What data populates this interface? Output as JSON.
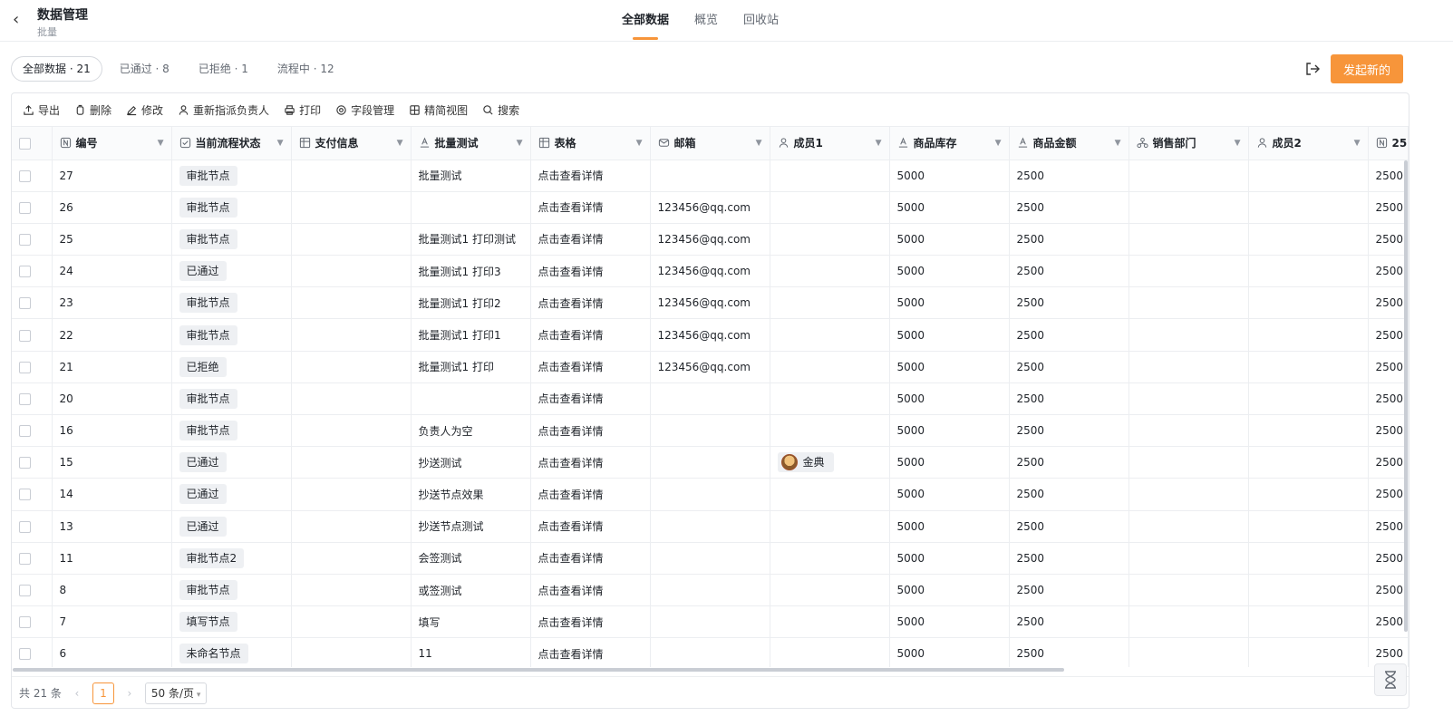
{
  "header": {
    "title": "数据管理",
    "subtitle": "批量"
  },
  "main_tabs": [
    {
      "label": "全部数据",
      "active": true
    },
    {
      "label": "概览",
      "active": false
    },
    {
      "label": "回收站",
      "active": false
    }
  ],
  "filters": [
    {
      "label": "全部数据 · 21",
      "active": true
    },
    {
      "label": "已通过 · 8",
      "active": false
    },
    {
      "label": "已拒绝 · 1",
      "active": false
    },
    {
      "label": "流程中 · 12",
      "active": false
    }
  ],
  "primary_button": "发起新的",
  "toolbar": [
    {
      "label": "导出",
      "icon": "export-icon"
    },
    {
      "label": "删除",
      "icon": "trash-icon"
    },
    {
      "label": "修改",
      "icon": "edit-icon"
    },
    {
      "label": "重新指派负责人",
      "icon": "user-icon"
    },
    {
      "label": "打印",
      "icon": "printer-icon"
    },
    {
      "label": "字段管理",
      "icon": "settings-icon"
    },
    {
      "label": "精简视图",
      "icon": "grid-icon"
    },
    {
      "label": "搜索",
      "icon": "search-icon"
    }
  ],
  "columns": [
    {
      "label": "编号",
      "icon": "number-icon"
    },
    {
      "label": "当前流程状态",
      "icon": "status-icon"
    },
    {
      "label": "支付信息",
      "icon": "table-icon"
    },
    {
      "label": "批量测试",
      "icon": "text-icon"
    },
    {
      "label": "表格",
      "icon": "table-icon"
    },
    {
      "label": "邮箱",
      "icon": "mail-icon"
    },
    {
      "label": "成员1",
      "icon": "user-icon"
    },
    {
      "label": "商品库存",
      "icon": "text-icon"
    },
    {
      "label": "商品金额",
      "icon": "text-icon"
    },
    {
      "label": "销售部门",
      "icon": "department-icon"
    },
    {
      "label": "成员2",
      "icon": "user-icon"
    },
    {
      "label": "25",
      "icon": "number-icon"
    }
  ],
  "rows": [
    {
      "id": "27",
      "status": "审批节点",
      "pay": "",
      "batch": "批量测试",
      "table": "点击查看详情",
      "email": "",
      "member1": "",
      "stock": "5000",
      "amount": "2500",
      "dept": "",
      "member2": "",
      "extra": "2500"
    },
    {
      "id": "26",
      "status": "审批节点",
      "pay": "",
      "batch": "",
      "table": "点击查看详情",
      "email": "123456@qq.com",
      "member1": "",
      "stock": "5000",
      "amount": "2500",
      "dept": "",
      "member2": "",
      "extra": "2500"
    },
    {
      "id": "25",
      "status": "审批节点",
      "pay": "",
      "batch": "批量测试1 打印测试",
      "table": "点击查看详情",
      "email": "123456@qq.com",
      "member1": "",
      "stock": "5000",
      "amount": "2500",
      "dept": "",
      "member2": "",
      "extra": "2500"
    },
    {
      "id": "24",
      "status": "已通过",
      "pay": "",
      "batch": "批量测试1 打印3",
      "table": "点击查看详情",
      "email": "123456@qq.com",
      "member1": "",
      "stock": "5000",
      "amount": "2500",
      "dept": "",
      "member2": "",
      "extra": "2500"
    },
    {
      "id": "23",
      "status": "审批节点",
      "pay": "",
      "batch": "批量测试1 打印2",
      "table": "点击查看详情",
      "email": "123456@qq.com",
      "member1": "",
      "stock": "5000",
      "amount": "2500",
      "dept": "",
      "member2": "",
      "extra": "2500"
    },
    {
      "id": "22",
      "status": "审批节点",
      "pay": "",
      "batch": "批量测试1 打印1",
      "table": "点击查看详情",
      "email": "123456@qq.com",
      "member1": "",
      "stock": "5000",
      "amount": "2500",
      "dept": "",
      "member2": "",
      "extra": "2500"
    },
    {
      "id": "21",
      "status": "已拒绝",
      "pay": "",
      "batch": "批量测试1 打印",
      "table": "点击查看详情",
      "email": "123456@qq.com",
      "member1": "",
      "stock": "5000",
      "amount": "2500",
      "dept": "",
      "member2": "",
      "extra": "2500"
    },
    {
      "id": "20",
      "status": "审批节点",
      "pay": "",
      "batch": "",
      "table": "点击查看详情",
      "email": "",
      "member1": "",
      "stock": "5000",
      "amount": "2500",
      "dept": "",
      "member2": "",
      "extra": "2500"
    },
    {
      "id": "16",
      "status": "审批节点",
      "pay": "",
      "batch": "负责人为空",
      "table": "点击查看详情",
      "email": "",
      "member1": "",
      "stock": "5000",
      "amount": "2500",
      "dept": "",
      "member2": "",
      "extra": "2500"
    },
    {
      "id": "15",
      "status": "已通过",
      "pay": "",
      "batch": "抄送测试",
      "table": "点击查看详情",
      "email": "",
      "member1": "金典",
      "stock": "5000",
      "amount": "2500",
      "dept": "",
      "member2": "",
      "extra": "2500"
    },
    {
      "id": "14",
      "status": "已通过",
      "pay": "",
      "batch": "抄送节点效果",
      "table": "点击查看详情",
      "email": "",
      "member1": "",
      "stock": "5000",
      "amount": "2500",
      "dept": "",
      "member2": "",
      "extra": "2500"
    },
    {
      "id": "13",
      "status": "已通过",
      "pay": "",
      "batch": "抄送节点测试",
      "table": "点击查看详情",
      "email": "",
      "member1": "",
      "stock": "5000",
      "amount": "2500",
      "dept": "",
      "member2": "",
      "extra": "2500"
    },
    {
      "id": "11",
      "status": "审批节点2",
      "pay": "",
      "batch": "会签测试",
      "table": "点击查看详情",
      "email": "",
      "member1": "",
      "stock": "5000",
      "amount": "2500",
      "dept": "",
      "member2": "",
      "extra": "2500"
    },
    {
      "id": "8",
      "status": "审批节点",
      "pay": "",
      "batch": "或签测试",
      "table": "点击查看详情",
      "email": "",
      "member1": "",
      "stock": "5000",
      "amount": "2500",
      "dept": "",
      "member2": "",
      "extra": "2500"
    },
    {
      "id": "7",
      "status": "填写节点",
      "pay": "",
      "batch": "填写",
      "table": "点击查看详情",
      "email": "",
      "member1": "",
      "stock": "5000",
      "amount": "2500",
      "dept": "",
      "member2": "",
      "extra": "2500"
    },
    {
      "id": "6",
      "status": "未命名节点",
      "pay": "",
      "batch": "11",
      "table": "点击查看详情",
      "email": "",
      "member1": "",
      "stock": "5000",
      "amount": "2500",
      "dept": "",
      "member2": "",
      "extra": "2500"
    }
  ],
  "pager": {
    "total": "共 21 条",
    "prev": "‹",
    "page": "1",
    "next": "›",
    "size": "50 条/页"
  },
  "colors": {
    "accent": "#f7953a",
    "border": "#eceef1",
    "tag_bg": "#eef0f3"
  }
}
